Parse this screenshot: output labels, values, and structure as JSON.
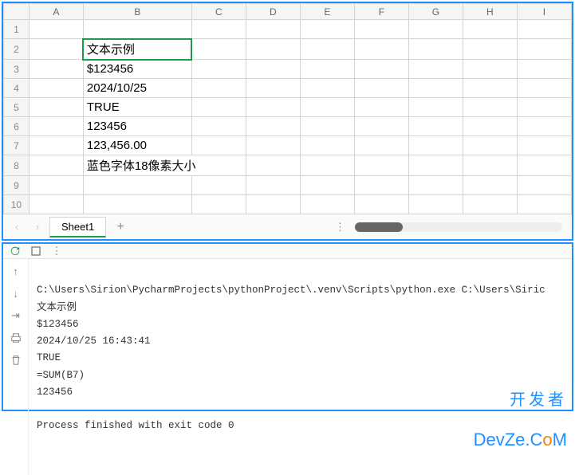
{
  "spreadsheet": {
    "columns": [
      "A",
      "B",
      "C",
      "D",
      "E",
      "F",
      "G",
      "H",
      "I"
    ],
    "row_numbers": [
      1,
      2,
      3,
      4,
      5,
      6,
      7,
      8,
      9,
      10
    ],
    "selected_cell": "B2",
    "cells": {
      "B2": "文本示例",
      "B3": "$123456",
      "B4": "2024/10/25",
      "B5": "TRUE",
      "B6": "123456",
      "B7": "123,456.00",
      "B8": "蓝色字体18像素大小"
    },
    "sheet_tab": "Sheet1"
  },
  "console": {
    "cmd_line": "C:\\Users\\Sirion\\PycharmProjects\\pythonProject\\.venv\\Scripts\\python.exe C:\\Users\\Siric",
    "lines": [
      "文本示例",
      "$123456",
      "2024/10/25 16:43:41",
      "TRUE",
      "=SUM(B7)",
      "123456",
      "",
      "Process finished with exit code 0"
    ]
  },
  "watermark": {
    "cn": "开发者",
    "en_pre": "DevZe.C",
    "en_o": "o",
    "en_post": "M"
  }
}
